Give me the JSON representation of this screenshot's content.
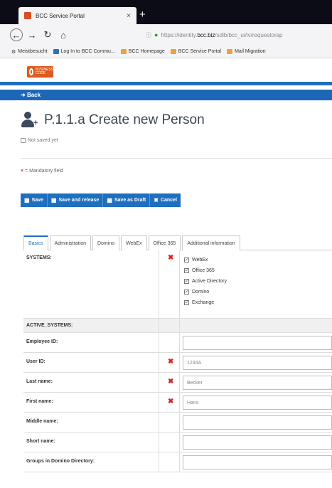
{
  "browser": {
    "tab_title": "BCC Service Portal",
    "tab_close": "×",
    "new_tab": "+",
    "url_prefix": "https://identity.",
    "url_host": "bcc.biz",
    "url_rest": "/sdlb/bcc_ui/iv/requestorap",
    "bookmarks": [
      "Meistbesucht",
      "Log In to BCC Commu...",
      "BCC Homepage",
      "BCC Service Portal",
      "Mail Migration"
    ]
  },
  "header": {
    "logo_text": "BUSINESS CODE",
    "back_label": "Back"
  },
  "page": {
    "title": "P.1.1.a Create new Person",
    "saved_status": "Not saved yet",
    "mandatory_note": "= Mandatory field",
    "mandatory_mark": "×"
  },
  "actions": {
    "save": "Save",
    "save_release": "Save and release",
    "save_draft": "Save as Draft",
    "cancel": "Cancel"
  },
  "tabs": [
    "Basics",
    "Administration",
    "Domino",
    "WebEx",
    "Office 365",
    "Additional information"
  ],
  "form": {
    "systems_label": "SYSTEMS:",
    "systems": [
      "WebEx",
      "Office 365",
      "Active Directory",
      "Domino",
      "Exchange"
    ],
    "active_systems_label": "ACTIVE_SYSTEMS:",
    "employee_id_label": "Employee ID:",
    "user_id_label": "User ID:",
    "user_id_value": "1234A",
    "last_name_label": "Last name:",
    "last_name_value": "Becker",
    "first_name_label": "First name:",
    "first_name_value": "Hans",
    "middle_name_label": "Middle name:",
    "short_name_label": "Short name:",
    "groups_label": "Groups in Domino Directory:"
  },
  "colors": {
    "accent": "#1e6fbe",
    "required": "#d92525",
    "logo": "#dd5b1e"
  }
}
